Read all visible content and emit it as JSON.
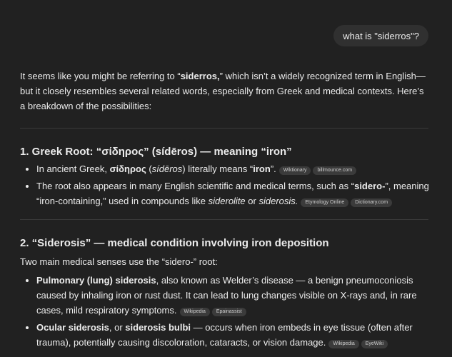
{
  "user_message": "what is \"siderros\"?",
  "intro": {
    "a": "It seems like you might be referring to “",
    "b": "siderros,",
    "c": "” which isn’t a widely recognized term in English—but it closely resembles several related words, especially from Greek and medical contexts. Here’s a breakdown of the possibilities:"
  },
  "section1": {
    "title": "1. Greek Root: “σίδηρος” (sídēros) — meaning “iron”",
    "bullet1": {
      "a": "In ancient Greek, ",
      "b": "σίδηρος",
      "c": " (",
      "d": "sídēros",
      "e": ") literally means “",
      "f": "iron",
      "g": "”.",
      "chips": [
        "Wiktionary",
        "billmounce.com"
      ]
    },
    "bullet2": {
      "a": "The root also appears in many English scientific and medical terms, such as “",
      "b": "sidero-",
      "c": "”, meaning “iron-containing,” used in compounds like ",
      "d": "siderolite",
      "e": " or ",
      "f": "siderosis.",
      "chips": [
        "Etymology Online",
        "Dictionary.com"
      ]
    }
  },
  "section2": {
    "title": "2. “Siderosis” — medical condition involving iron deposition",
    "lead": "Two main medical senses use the “sidero-” root:",
    "bullet1": {
      "a": "Pulmonary (lung) siderosis",
      "b": ", also known as Welder’s disease — a benign pneumoconiosis caused by inhaling iron or rust dust. It can lead to lung changes visible on X-rays and, in rare cases, mild respiratory symptoms.",
      "chips": [
        "Wikipedia",
        "Epainassist"
      ]
    },
    "bullet2": {
      "a": "Ocular siderosis",
      "b": ", or ",
      "c": "siderosis bulbi",
      "d": " — occurs when iron embeds in eye tissue (often after trauma), potentially causing discoloration, cataracts, or vision damage.",
      "chips": [
        "Wikipedia",
        "EyeWiki"
      ]
    }
  }
}
